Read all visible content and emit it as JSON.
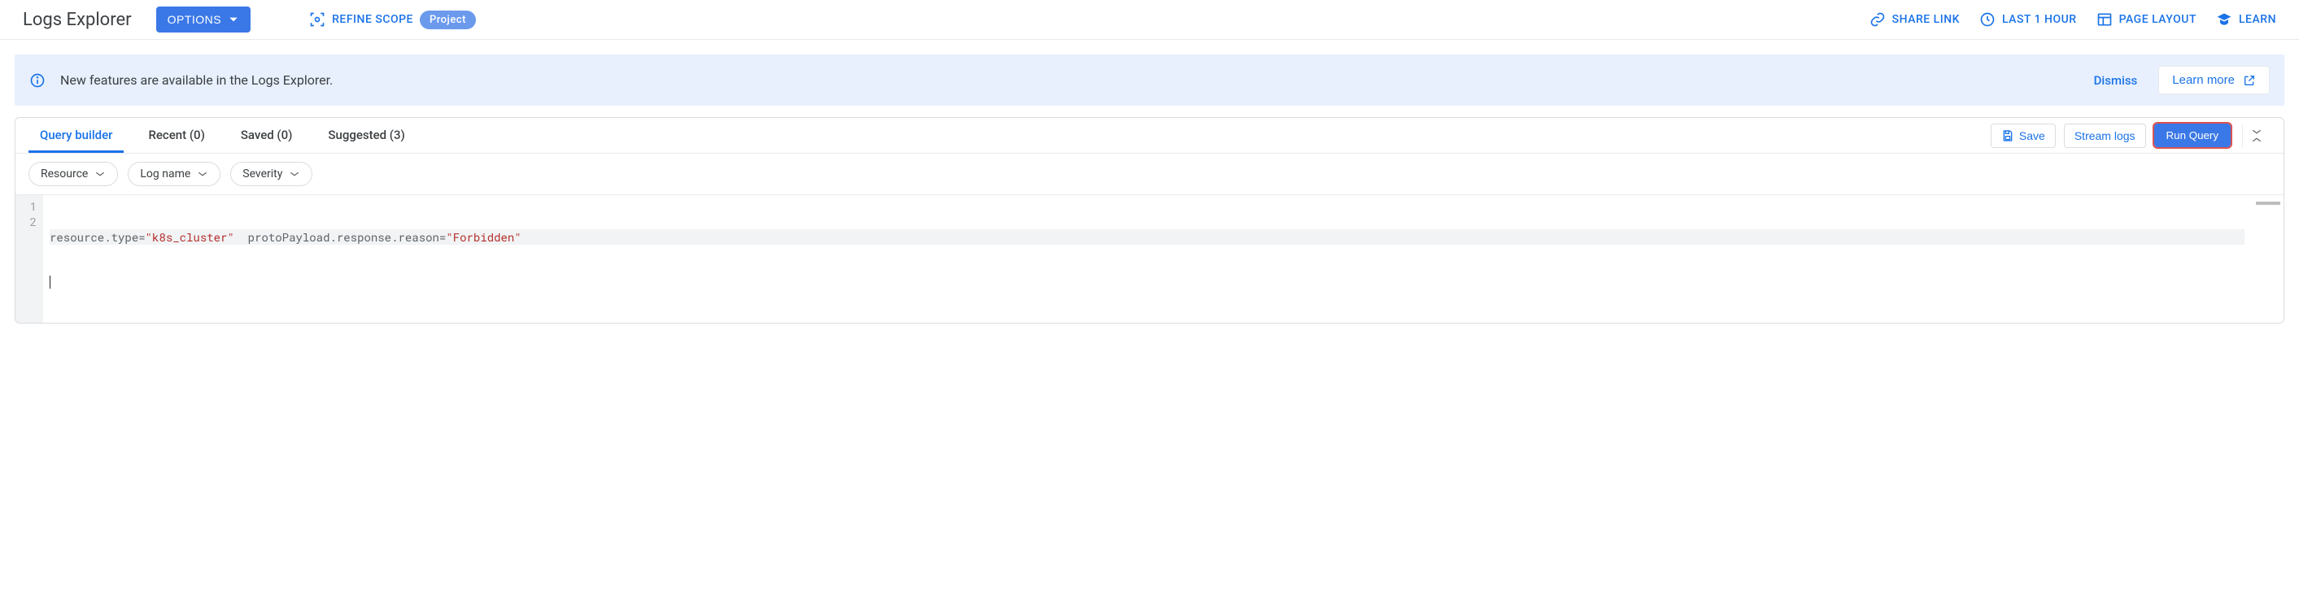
{
  "header": {
    "title": "Logs Explorer",
    "options_label": "OPTIONS",
    "refine_scope_label": "REFINE SCOPE",
    "scope_badge": "Project",
    "share_link_label": "SHARE LINK",
    "time_range_label": "LAST 1 HOUR",
    "page_layout_label": "PAGE LAYOUT",
    "learn_label": "LEARN"
  },
  "notification": {
    "text": "New features are available in the Logs Explorer.",
    "dismiss_label": "Dismiss",
    "learn_more_label": "Learn more"
  },
  "tabs": {
    "query_builder": "Query builder",
    "recent": "Recent (0)",
    "saved": "Saved (0)",
    "suggested": "Suggested (3)",
    "save_label": "Save",
    "stream_label": "Stream logs",
    "run_query_label": "Run Query"
  },
  "filters": {
    "resource": "Resource",
    "log_name": "Log name",
    "severity": "Severity"
  },
  "editor": {
    "line1": {
      "k1": "resource.type",
      "v1": "\"k8s_cluster\"",
      "k2": "protoPayload.response.reason",
      "v2": "\"Forbidden\""
    },
    "gutter1": "1",
    "gutter2": "2"
  }
}
